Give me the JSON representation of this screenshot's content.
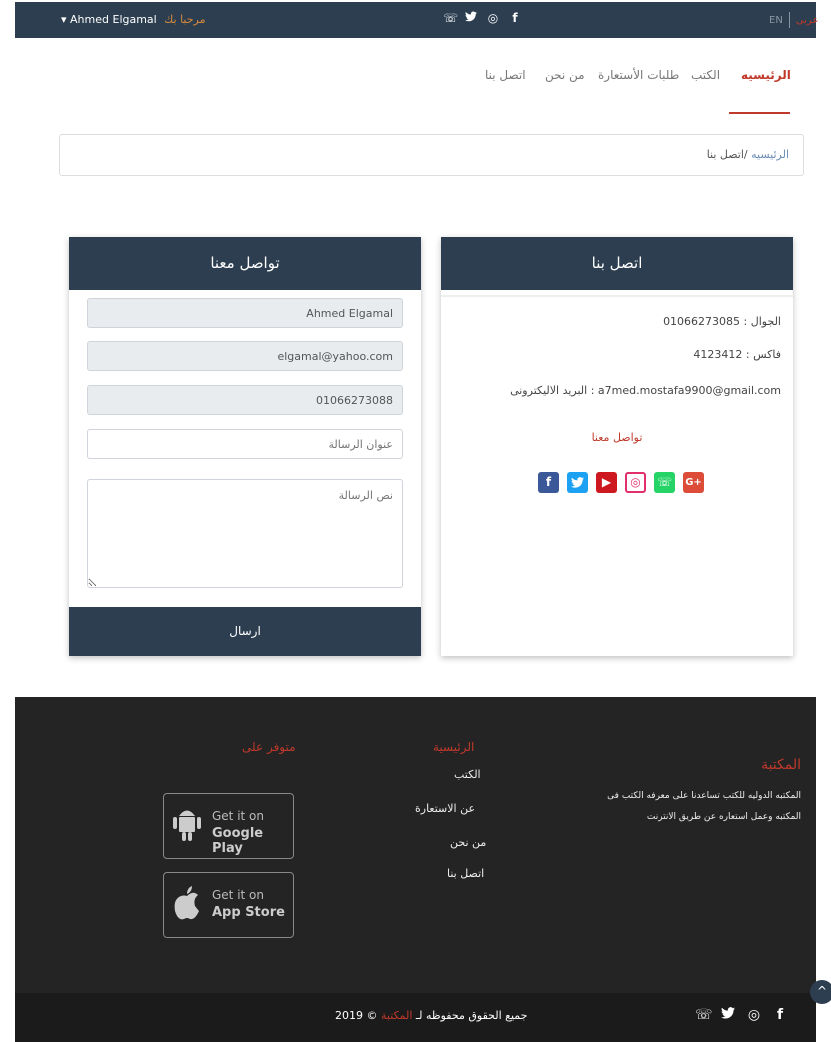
{
  "topbar": {
    "user_name": "Ahmed Elgamal",
    "welcome": "مرحبا بك",
    "lang_en": "EN",
    "lang_ar": "عربى",
    "social_icons": [
      "whatsapp-icon",
      "twitter-icon",
      "instagram-icon",
      "facebook-icon"
    ]
  },
  "nav": {
    "items": [
      {
        "label": "الرئيسيه",
        "active": true
      },
      {
        "label": "الكتب"
      },
      {
        "label": "طلبات الأستعارة"
      },
      {
        "label": "من نحن"
      },
      {
        "label": "اتصل بنا"
      }
    ]
  },
  "breadcrumb": {
    "home": "الرئيسيه",
    "separator": " /",
    "current": "اتصل بنا"
  },
  "contact_info": {
    "title": "اتصل بنا",
    "mobile": "الجوال : 01066273085",
    "fax": "فاكس : 4123412",
    "email": "البريد الاليكترونى : a7med.mostafa9900@gmail.com",
    "contact_link": "تواصل معنا",
    "social_colors": {
      "facebook": "#3b5998",
      "twitter": "#1da1f2",
      "youtube": "#cc181e",
      "instagram": "#e1306c",
      "whatsapp": "#25d366",
      "google_plus": "#dd4b39"
    }
  },
  "contact_form": {
    "title": "تواصل معنا",
    "name_value": "Ahmed Elgamal",
    "email_value": "elgamal@yahoo.com",
    "phone_value": "01066273088",
    "subject_placeholder": "عنوان الرسالة",
    "message_placeholder": "نص الرسالة",
    "submit_label": "ارسال"
  },
  "footer": {
    "about_title": "المكتبة",
    "about_line1": "المكتبه الدوليه للكتب تساعدنا على معرفه الكتب فى",
    "about_line2": "المكتبه وعمل استعاره عن طريق الانترنت",
    "links_title": "الرئيسية",
    "links": [
      "الكتب",
      "عن الاستعارة",
      "من نحن",
      "اتصل بنا"
    ],
    "available_title": "متوفر على",
    "google_play_small": "Get it on",
    "google_play_big": "Google Play",
    "app_store_small": "Get it on",
    "app_store_big": "App Store"
  },
  "bottombar": {
    "copyright_text": "جميع الحقوق محفوظه لـ",
    "brand": "المكتبة",
    "year": "© 2019"
  },
  "colors": {
    "dark": "#2c3e50",
    "accent": "#c0392b",
    "footer_bg": "#242424"
  }
}
